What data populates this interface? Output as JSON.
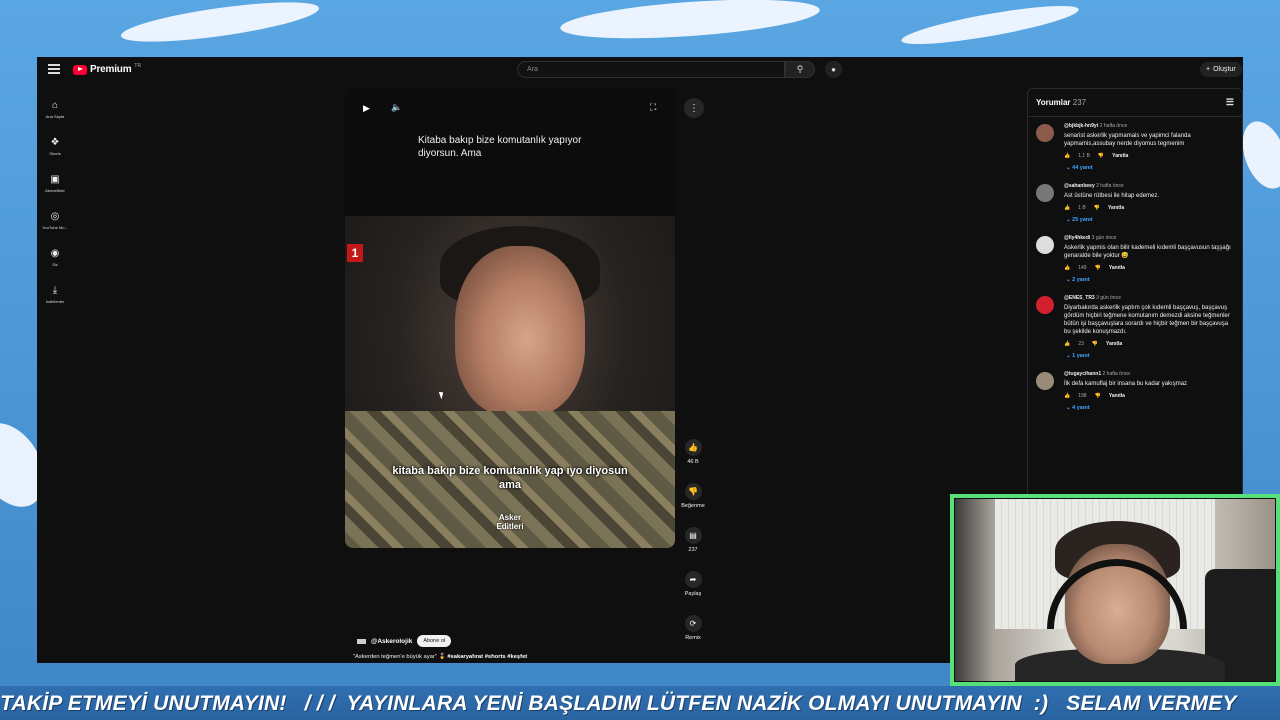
{
  "topbar": {
    "brand": "Premium",
    "brand_region": "TR",
    "search_placeholder": "Ara",
    "create_label": "Oluştur"
  },
  "sidebar": {
    "items": [
      {
        "label": "Ana Sayfa",
        "icon": "home-icon"
      },
      {
        "label": "Shorts",
        "icon": "shorts-icon"
      },
      {
        "label": "Abonelikler",
        "icon": "subscriptions-icon"
      },
      {
        "label": "YouTube Mu...",
        "icon": "youtube-music-icon"
      },
      {
        "label": "Siz",
        "icon": "user-icon"
      },
      {
        "label": "İndirilenler",
        "icon": "download-icon"
      }
    ]
  },
  "short": {
    "top_caption": "Kitaba bakıp bize komutanlık yapıyor diyorsun. Ama",
    "channel_logo": "1",
    "subtitle": "kitaba bakıp bize komutanlık yap ıyo diyosun ama",
    "watermark": "Asker Editleri",
    "channel": "@Askerolojik",
    "subscribe_label": "Abone ol",
    "description_plain": "\"Askerden teğmen'e büyük ayar\" 🎖️",
    "description_tags": "#sakaryafırat #shorts #keşfet"
  },
  "actions": {
    "like_count": "46 B",
    "dislike_label": "Beğenme",
    "comment_count": "237",
    "share_label": "Paylaş",
    "remix_label": "Remix"
  },
  "comments": {
    "title": "Yorumlar",
    "count": "237",
    "items": [
      {
        "author": "@bjkbjk-hn9yt",
        "time": "2 hafta önce",
        "text": "senarist askerlik yapmamais ve yapimci falanda yapmamis,assubay nerde diyomus tegmenim",
        "likes": "1,1 B",
        "reply": "Yanıtla",
        "replies": "44 yanıt",
        "avatar_color": "#8a5a4a"
      },
      {
        "author": "@sahanbeey",
        "time": "2 hafta önce",
        "text": "Ast üstüne rütbesi ile hitap edemez.",
        "likes": "1 B",
        "reply": "Yanıtla",
        "replies": "25 yanıt",
        "avatar_color": "#777777"
      },
      {
        "author": "@lly4hkedi",
        "time": "3 gün önce",
        "text": "Askerlik yapmis olan bilir kademeli kıdemli başçavusun taşşağı genaralde bile yoktur 😅",
        "likes": "149",
        "reply": "Yanıtla",
        "replies": "2 yanıt",
        "avatar_color": "#dddddd"
      },
      {
        "author": "@ENES_TR3",
        "time": "3 gün önce",
        "text": "Diyarbakırda askerlik yaptım çok kıdemli başçavuş, başçavuş gördüm hiçbiri teğmene komutanım demezdi aksine teğmenler bütün işi başçavuşlara sorardı ve hiçbir teğmen bir başçavuşa bu şekilde konuşmazdı.",
        "likes": "23",
        "reply": "Yanıtla",
        "replies": "1 yanıt",
        "avatar_color": "#d2202f"
      },
      {
        "author": "@tugaycihann1",
        "time": "2 hafta önce",
        "text": "İlk defa kamuflaj bir insana bu kadar yakışmaz",
        "likes": "198",
        "reply": "Yanıtla",
        "replies": "4 yanıt",
        "avatar_color": "#9a8a78"
      }
    ]
  },
  "ticker": {
    "text": "TAKİP ETMEYİ UNUTMAYIN!   / / /  YAYINLARA YENİ BAŞLADIM LÜTFEN NAZİK OLMAYI UNUTMAYIN  :)   SELAM VERMEY"
  }
}
